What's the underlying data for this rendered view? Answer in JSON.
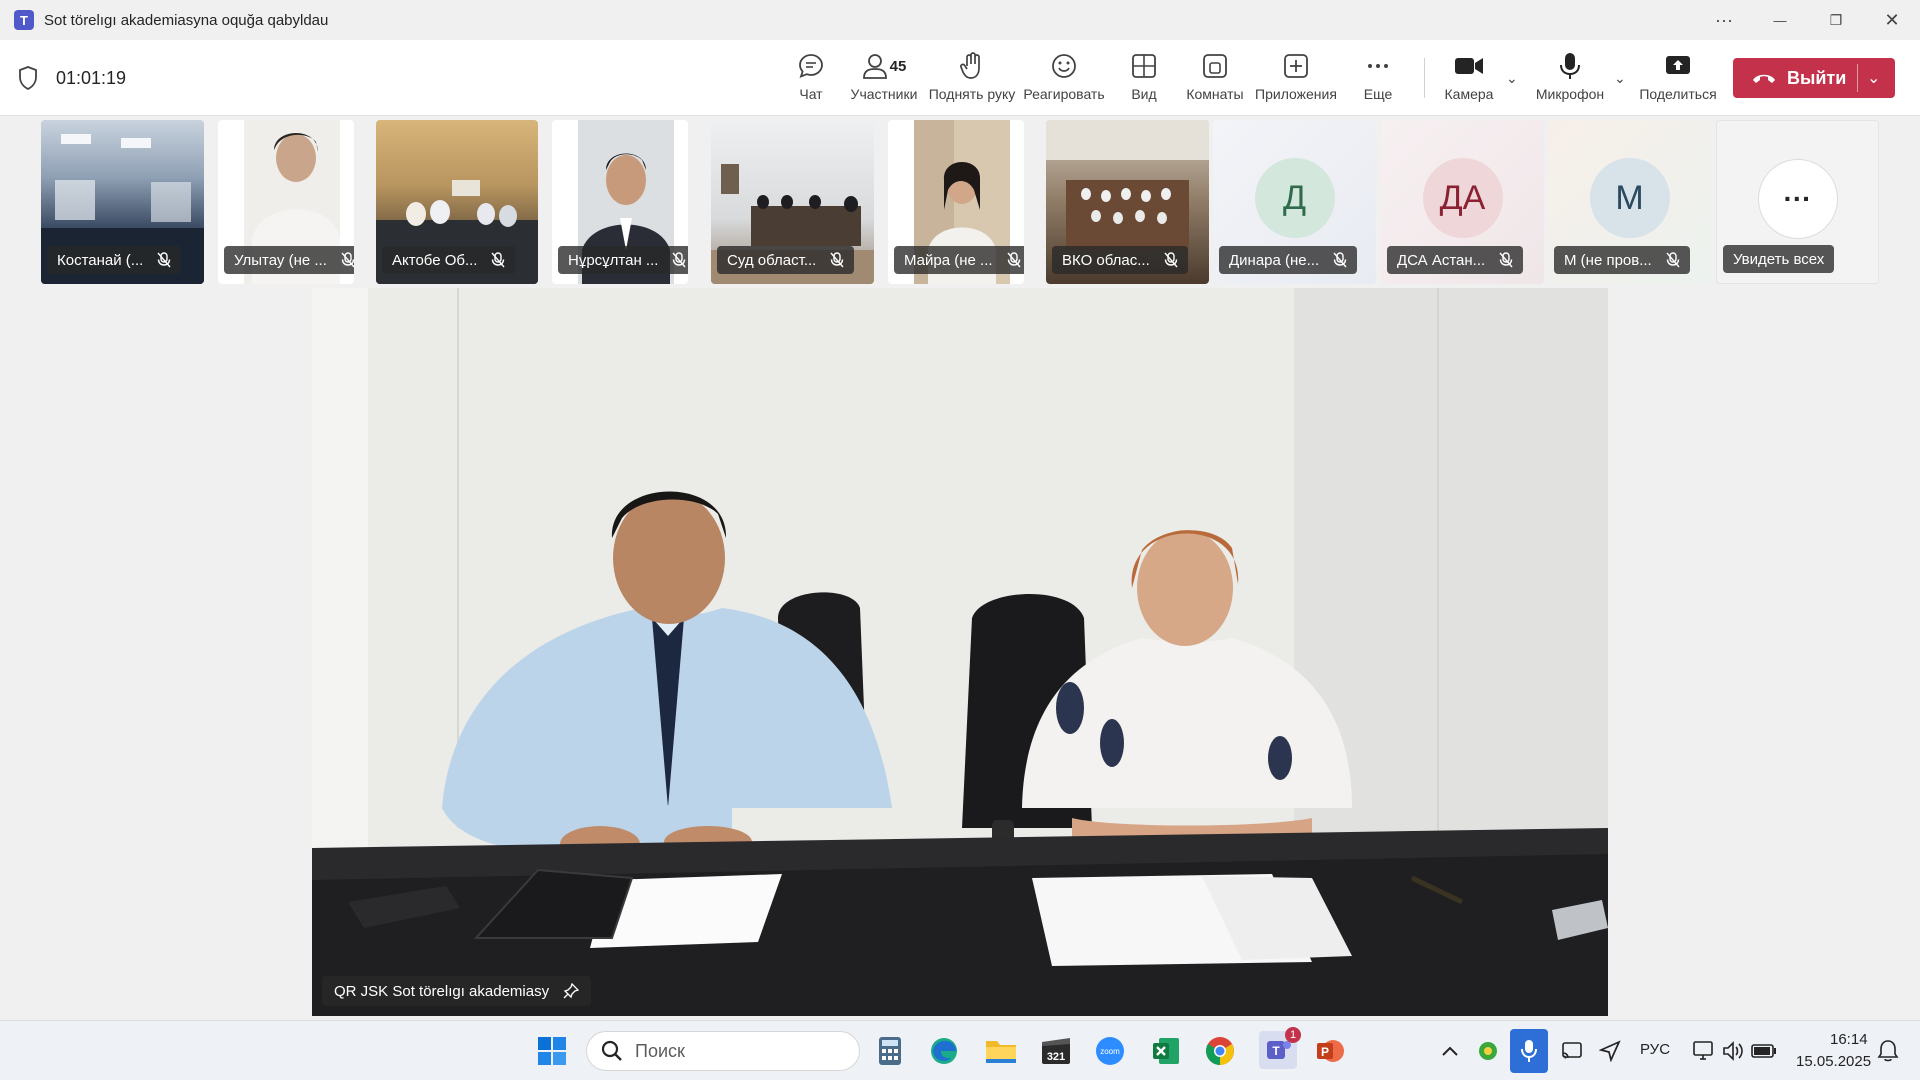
{
  "window": {
    "title": "Sot törelıgı akademiasyna oquğa qabyldau",
    "more_glyph": "···",
    "minimize_glyph": "—",
    "restore_glyph": "❐",
    "close_glyph": "✕"
  },
  "meeting": {
    "timer": "01:01:19",
    "toolbar": {
      "chat": "Чат",
      "participants": "Участники",
      "participants_count": "45",
      "raise_hand": "Поднять руку",
      "react": "Реагировать",
      "view": "Вид",
      "rooms": "Комнаты",
      "apps": "Приложения",
      "more": "Еще",
      "camera": "Камера",
      "microphone": "Микрофон",
      "share": "Поделиться",
      "leave": "Выйти"
    }
  },
  "participants": [
    {
      "name": "Костанай (...",
      "kind": "video"
    },
    {
      "name": "Улытау (не ...",
      "kind": "video"
    },
    {
      "name": "Актобе Об...",
      "kind": "video"
    },
    {
      "name": "Нұрсұлтан ...",
      "kind": "video"
    },
    {
      "name": "Суд област...",
      "kind": "video"
    },
    {
      "name": "Майра (не ...",
      "kind": "video"
    },
    {
      "name": "ВКО облас...",
      "kind": "video"
    },
    {
      "name": "Динара (не...",
      "kind": "avatar",
      "initials": "Д"
    },
    {
      "name": "ДСА Астан...",
      "kind": "avatar",
      "initials": "ДА"
    },
    {
      "name": "М (не пров...",
      "kind": "avatar",
      "initials": "М"
    }
  ],
  "see_all": {
    "label": "Увидеть всех",
    "glyph": "···"
  },
  "stage": {
    "presenter": "QR JSK Sot törelıgı akademiasy"
  },
  "taskbar": {
    "search_placeholder": "Поиск",
    "teams_badge": "1",
    "zoom_label": "zoom",
    "calendar_label": "321",
    "language": "РУС",
    "time": "16:14",
    "date": "15.05.2025"
  },
  "colors": {
    "accent": "#5b5fc7",
    "leave": "#c4314b",
    "avatar_d": "#d3e7dc",
    "avatar_da": "#efd6d9",
    "avatar_m": "#d7e2e9"
  }
}
